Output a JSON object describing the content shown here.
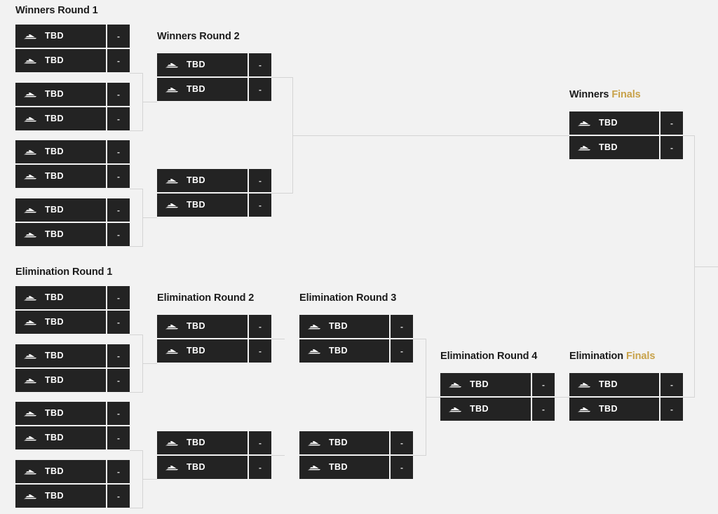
{
  "page": {
    "background_color": "#f2f2f2",
    "box_color": "#232323",
    "accent_color": "#c8a24a",
    "line_color": "#d4d4d4",
    "placeholder_team": "TBD",
    "placeholder_score": "-",
    "team_icon": "speedboat-icon"
  },
  "headings": {
    "winners_round_1": {
      "text": "Winners Round 1",
      "accent": ""
    },
    "winners_round_2": {
      "text": "Winners Round 2",
      "accent": ""
    },
    "winners_finals": {
      "text": "Winners ",
      "accent": "Finals"
    },
    "elimination_round_1": {
      "text": "Elimination Round 1",
      "accent": ""
    },
    "elimination_round_2": {
      "text": "Elimination Round 2",
      "accent": ""
    },
    "elimination_round_3": {
      "text": "Elimination Round 3",
      "accent": ""
    },
    "elimination_round_4": {
      "text": "Elimination Round 4",
      "accent": ""
    },
    "elimination_finals": {
      "text": "Elimination ",
      "accent": "Finals"
    }
  },
  "rounds": [
    {
      "id": "winners-round-1",
      "name": "Winners Round 1",
      "matches": [
        {
          "id": "wr1-m1",
          "slots": [
            {
              "team": "TBD",
              "score": "-"
            },
            {
              "team": "TBD",
              "score": "-"
            }
          ]
        },
        {
          "id": "wr1-m2",
          "slots": [
            {
              "team": "TBD",
              "score": "-"
            },
            {
              "team": "TBD",
              "score": "-"
            }
          ]
        },
        {
          "id": "wr1-m3",
          "slots": [
            {
              "team": "TBD",
              "score": "-"
            },
            {
              "team": "TBD",
              "score": "-"
            }
          ]
        },
        {
          "id": "wr1-m4",
          "slots": [
            {
              "team": "TBD",
              "score": "-"
            },
            {
              "team": "TBD",
              "score": "-"
            }
          ]
        }
      ]
    },
    {
      "id": "winners-round-2",
      "name": "Winners Round 2",
      "matches": [
        {
          "id": "wr2-m1",
          "slots": [
            {
              "team": "TBD",
              "score": "-"
            },
            {
              "team": "TBD",
              "score": "-"
            }
          ]
        },
        {
          "id": "wr2-m2",
          "slots": [
            {
              "team": "TBD",
              "score": "-"
            },
            {
              "team": "TBD",
              "score": "-"
            }
          ]
        }
      ]
    },
    {
      "id": "winners-finals",
      "name": "Winners Finals",
      "matches": [
        {
          "id": "wf-m1",
          "slots": [
            {
              "team": "TBD",
              "score": "-"
            },
            {
              "team": "TBD",
              "score": "-"
            }
          ]
        }
      ]
    },
    {
      "id": "elimination-round-1",
      "name": "Elimination Round 1",
      "matches": [
        {
          "id": "er1-m1",
          "slots": [
            {
              "team": "TBD",
              "score": "-"
            },
            {
              "team": "TBD",
              "score": "-"
            }
          ]
        },
        {
          "id": "er1-m2",
          "slots": [
            {
              "team": "TBD",
              "score": "-"
            },
            {
              "team": "TBD",
              "score": "-"
            }
          ]
        },
        {
          "id": "er1-m3",
          "slots": [
            {
              "team": "TBD",
              "score": "-"
            },
            {
              "team": "TBD",
              "score": "-"
            }
          ]
        },
        {
          "id": "er1-m4",
          "slots": [
            {
              "team": "TBD",
              "score": "-"
            },
            {
              "team": "TBD",
              "score": "-"
            }
          ]
        }
      ]
    },
    {
      "id": "elimination-round-2",
      "name": "Elimination Round 2",
      "matches": [
        {
          "id": "er2-m1",
          "slots": [
            {
              "team": "TBD",
              "score": "-"
            },
            {
              "team": "TBD",
              "score": "-"
            }
          ]
        },
        {
          "id": "er2-m2",
          "slots": [
            {
              "team": "TBD",
              "score": "-"
            },
            {
              "team": "TBD",
              "score": "-"
            }
          ]
        }
      ]
    },
    {
      "id": "elimination-round-3",
      "name": "Elimination Round 3",
      "matches": [
        {
          "id": "er3-m1",
          "slots": [
            {
              "team": "TBD",
              "score": "-"
            },
            {
              "team": "TBD",
              "score": "-"
            }
          ]
        },
        {
          "id": "er3-m2",
          "slots": [
            {
              "team": "TBD",
              "score": "-"
            },
            {
              "team": "TBD",
              "score": "-"
            }
          ]
        }
      ]
    },
    {
      "id": "elimination-round-4",
      "name": "Elimination Round 4",
      "matches": [
        {
          "id": "er4-m1",
          "slots": [
            {
              "team": "TBD",
              "score": "-"
            },
            {
              "team": "TBD",
              "score": "-"
            }
          ]
        }
      ]
    },
    {
      "id": "elimination-finals",
      "name": "Elimination Finals",
      "matches": [
        {
          "id": "ef-m1",
          "slots": [
            {
              "team": "TBD",
              "score": "-"
            },
            {
              "team": "TBD",
              "score": "-"
            }
          ]
        }
      ]
    }
  ]
}
